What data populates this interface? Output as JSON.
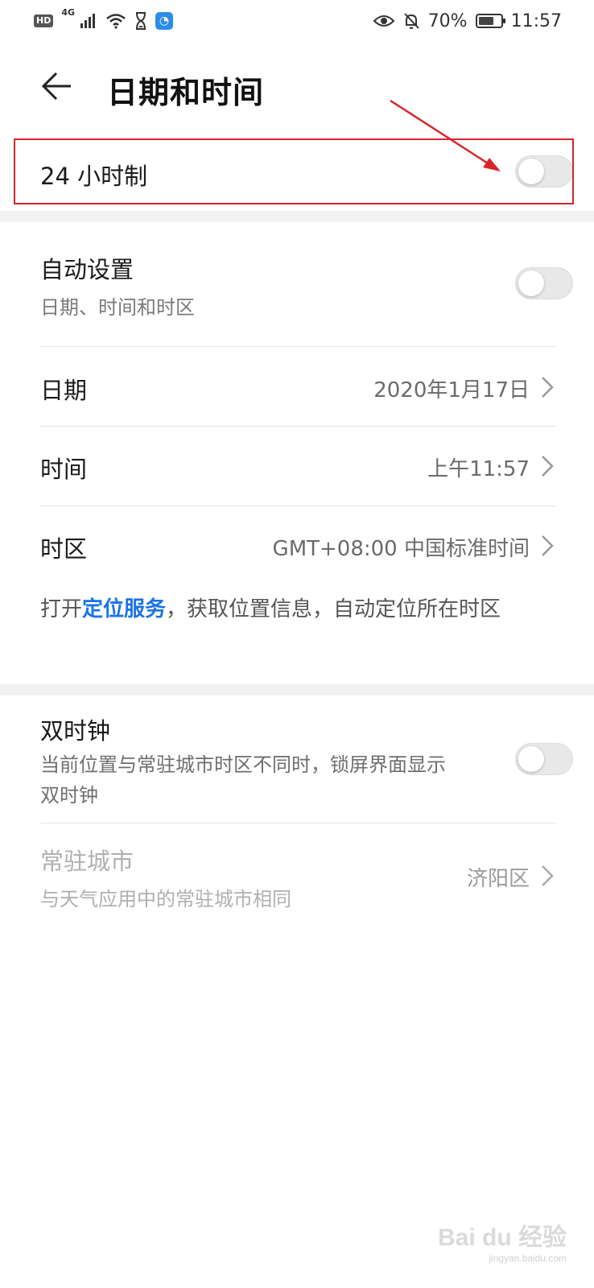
{
  "status_bar": {
    "hd": "HD",
    "network": "4G",
    "battery": "70%",
    "battery_level": 0.7,
    "time": "11:57",
    "icons": [
      "hd-icon",
      "signal-icon",
      "wifi-icon",
      "hourglass-icon",
      "app-notification-icon",
      "eye-comfort-icon",
      "mute-bell-icon",
      "battery-icon"
    ]
  },
  "header": {
    "title": "日期和时间",
    "back_icon": "back-arrow-icon"
  },
  "settings": {
    "hour24": {
      "label": "24 小时制",
      "enabled": false
    },
    "auto": {
      "label": "自动设置",
      "sub": "日期、时间和时区",
      "enabled": false
    },
    "date": {
      "label": "日期",
      "value": "2020年1月17日"
    },
    "time": {
      "label": "时间",
      "value": "上午11:57"
    },
    "timezone": {
      "label": "时区",
      "value": "GMT+08:00 中国标准时间"
    },
    "location_note": {
      "prefix": "打开",
      "link": "定位服务",
      "suffix": "，获取位置信息，自动定位所在时区"
    },
    "dual_clock": {
      "label": "双时钟",
      "sub": "当前位置与常驻城市时区不同时，锁屏界面显示双时钟",
      "enabled": false
    },
    "home_city": {
      "label": "常驻城市",
      "sub": "与天气应用中的常驻城市相同",
      "value": "济阳区"
    }
  },
  "colors": {
    "annotation": "#d9252b",
    "link": "#1a73e8",
    "toggle_off": "#e8e8e8"
  },
  "watermark": {
    "main": "Bai du 经验",
    "sub": "jingyan.baidu.com"
  }
}
